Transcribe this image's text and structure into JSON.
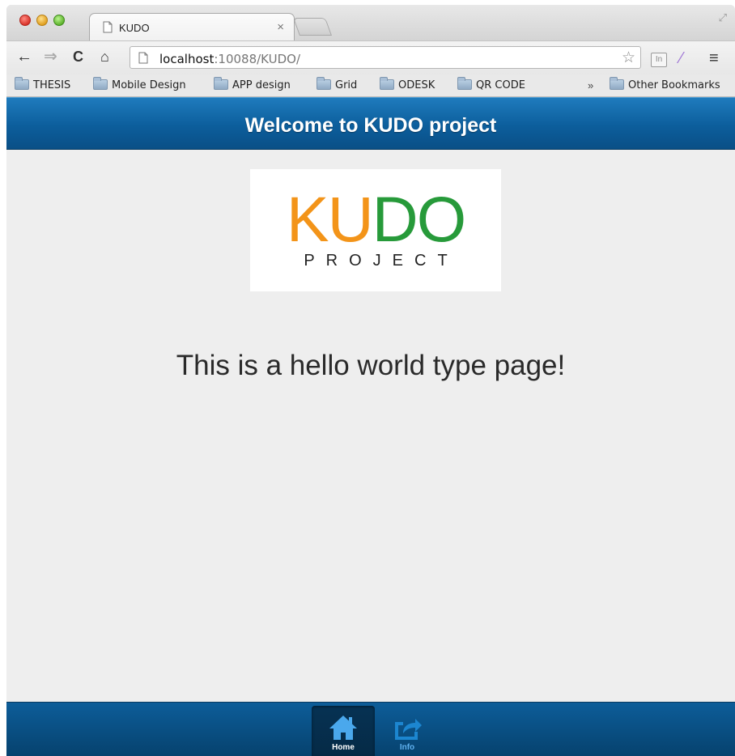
{
  "browser": {
    "tab": {
      "title": "KUDO",
      "close": "×"
    },
    "toolbar": {
      "back": "←",
      "forward": "⇒",
      "reload": "C",
      "home": "⌂",
      "url_host": "localhost",
      "url_rest": ":10088/KUDO/",
      "star": "☆",
      "ext_in": "In",
      "menu": "≡"
    },
    "bookmarks": [
      "THESIS",
      "Mobile Design",
      "APP design",
      "Grid",
      "ODESK",
      "QR CODE"
    ],
    "bookmarks_chevron": "»",
    "other_bookmarks": "Other Bookmarks"
  },
  "page": {
    "header_title": "Welcome to KUDO project",
    "logo": {
      "k": "K",
      "u": "U",
      "d": "D",
      "o": "O",
      "subtitle": "PROJECT",
      "colors": {
        "orange": "#f39419",
        "green": "#279a3a"
      }
    },
    "message": "This is a hello world type page!",
    "footer": {
      "home_label": "Home",
      "info_label": "Info"
    }
  }
}
